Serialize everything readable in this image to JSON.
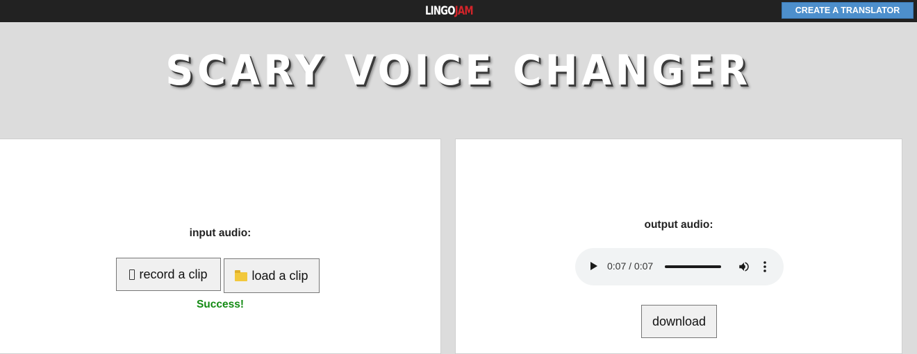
{
  "topbar": {
    "logo_part1": "LINGO",
    "logo_part2": "JAM",
    "create_button_label": "CREATE A TRANSLATOR"
  },
  "hero": {
    "title": "SCARY VOICE CHANGER"
  },
  "input_panel": {
    "label": "input audio:",
    "record_label": "record a clip",
    "record_icon": "microphone-icon",
    "load_label": "load a clip",
    "load_icon": "folder-icon",
    "status": "Success!"
  },
  "output_panel": {
    "label": "output audio:",
    "player": {
      "time": "0:07 / 0:07",
      "progress": 1.0
    },
    "download_label": "download"
  },
  "colors": {
    "topbar_bg": "#222222",
    "logo_accent": "#d2242a",
    "create_button_bg": "#4d8fcc",
    "success": "#128a12",
    "page_bg": "#dcdcdc"
  }
}
